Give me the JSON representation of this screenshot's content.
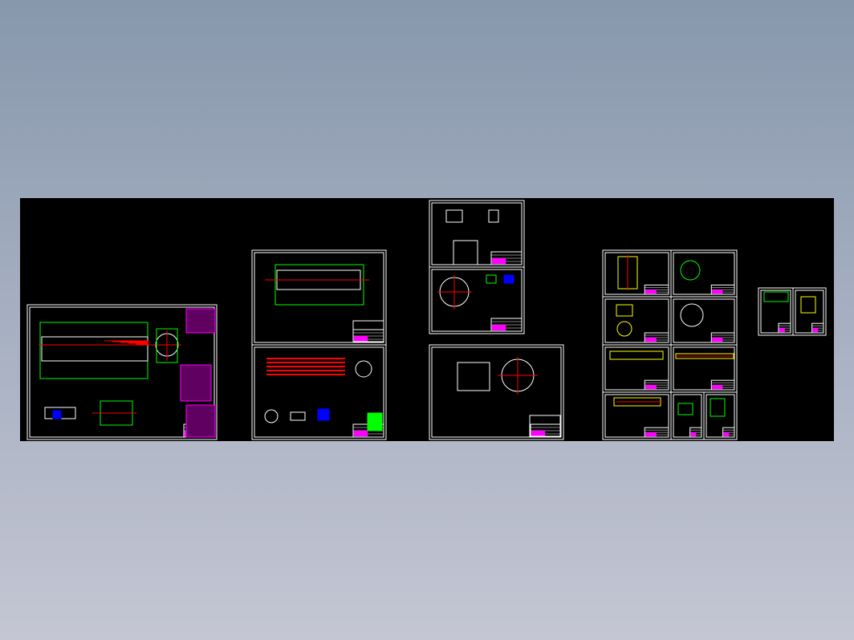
{
  "viewer": {
    "background_top": "#8797ac",
    "background_bottom": "#c4c6d3",
    "canvas_color": "#000000"
  },
  "drawing_colors": {
    "frame": "#ffffff",
    "outline": "#00ff00",
    "centerline": "#ff0000",
    "annotation": "#ff00ff",
    "detail": "#ffff00",
    "hatch": "#0000ff"
  }
}
